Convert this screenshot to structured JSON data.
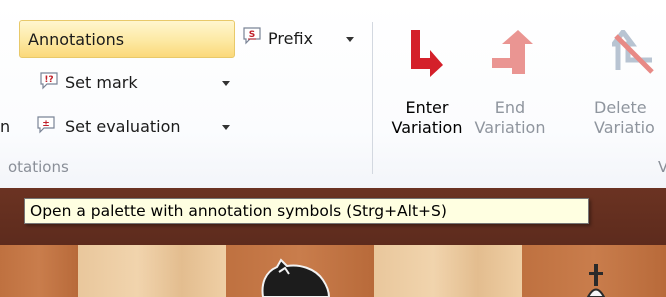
{
  "ribbon": {
    "annotations_button": "Annotations",
    "prefix_button": "Prefix",
    "set_mark_button": "Set mark",
    "set_evaluation_button": "Set evaluation",
    "left_clipped_text": "n",
    "annotations_group_label": "otations",
    "enter_variation": {
      "line1": "Enter",
      "line2": "Variation"
    },
    "end_variation": {
      "line1": "End",
      "line2": "Variation"
    },
    "delete_variation": {
      "line1": "Delete",
      "line2": "Variatio"
    },
    "variations_group_label": "V"
  },
  "tooltip": {
    "text": "Open a palette with annotation symbols (Strg+Alt+S)"
  },
  "icons": {
    "prefix": "speech-bubble-s-icon",
    "set_mark": "speech-bubble-exclaim-question-icon",
    "set_evaluation": "speech-bubble-plus-minus-icon",
    "enter_variation": "red-arrow-down-right-icon",
    "end_variation": "faded-red-arrow-up-icon",
    "delete_variation": "crossed-arrow-icon"
  },
  "colors": {
    "accent_highlight": "#fbd97a",
    "enter_arrow": "#d4202a",
    "end_arrow": "#e88a86",
    "tooltip_bg": "#ffffe1",
    "board_light": "#efcfa5",
    "board_dark": "#c07243"
  }
}
